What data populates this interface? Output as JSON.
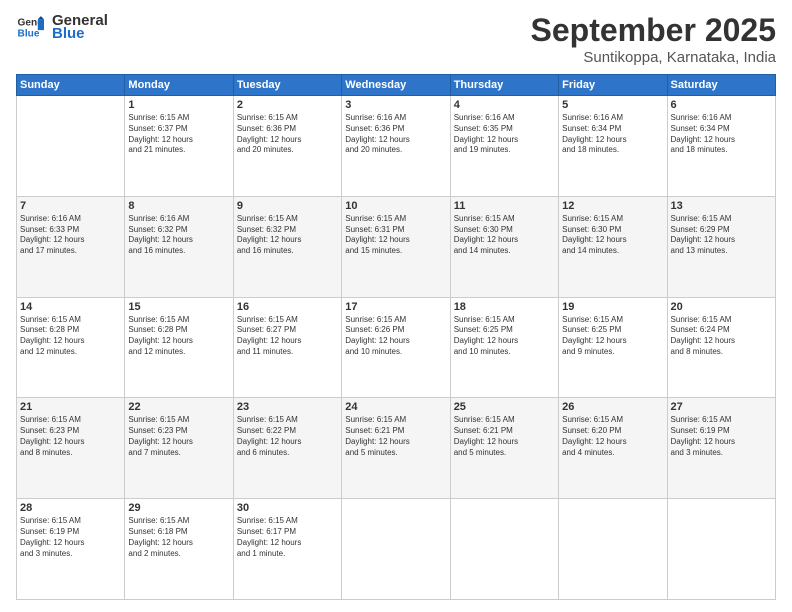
{
  "header": {
    "logo_general": "General",
    "logo_blue": "Blue",
    "month_title": "September 2025",
    "location": "Suntikoppa, Karnataka, India"
  },
  "columns": [
    "Sunday",
    "Monday",
    "Tuesday",
    "Wednesday",
    "Thursday",
    "Friday",
    "Saturday"
  ],
  "weeks": [
    [
      {
        "num": "",
        "info": ""
      },
      {
        "num": "1",
        "info": "Sunrise: 6:15 AM\nSunset: 6:37 PM\nDaylight: 12 hours\nand 21 minutes."
      },
      {
        "num": "2",
        "info": "Sunrise: 6:15 AM\nSunset: 6:36 PM\nDaylight: 12 hours\nand 20 minutes."
      },
      {
        "num": "3",
        "info": "Sunrise: 6:16 AM\nSunset: 6:36 PM\nDaylight: 12 hours\nand 20 minutes."
      },
      {
        "num": "4",
        "info": "Sunrise: 6:16 AM\nSunset: 6:35 PM\nDaylight: 12 hours\nand 19 minutes."
      },
      {
        "num": "5",
        "info": "Sunrise: 6:16 AM\nSunset: 6:34 PM\nDaylight: 12 hours\nand 18 minutes."
      },
      {
        "num": "6",
        "info": "Sunrise: 6:16 AM\nSunset: 6:34 PM\nDaylight: 12 hours\nand 18 minutes."
      }
    ],
    [
      {
        "num": "7",
        "info": "Sunrise: 6:16 AM\nSunset: 6:33 PM\nDaylight: 12 hours\nand 17 minutes."
      },
      {
        "num": "8",
        "info": "Sunrise: 6:16 AM\nSunset: 6:32 PM\nDaylight: 12 hours\nand 16 minutes."
      },
      {
        "num": "9",
        "info": "Sunrise: 6:15 AM\nSunset: 6:32 PM\nDaylight: 12 hours\nand 16 minutes."
      },
      {
        "num": "10",
        "info": "Sunrise: 6:15 AM\nSunset: 6:31 PM\nDaylight: 12 hours\nand 15 minutes."
      },
      {
        "num": "11",
        "info": "Sunrise: 6:15 AM\nSunset: 6:30 PM\nDaylight: 12 hours\nand 14 minutes."
      },
      {
        "num": "12",
        "info": "Sunrise: 6:15 AM\nSunset: 6:30 PM\nDaylight: 12 hours\nand 14 minutes."
      },
      {
        "num": "13",
        "info": "Sunrise: 6:15 AM\nSunset: 6:29 PM\nDaylight: 12 hours\nand 13 minutes."
      }
    ],
    [
      {
        "num": "14",
        "info": "Sunrise: 6:15 AM\nSunset: 6:28 PM\nDaylight: 12 hours\nand 12 minutes."
      },
      {
        "num": "15",
        "info": "Sunrise: 6:15 AM\nSunset: 6:28 PM\nDaylight: 12 hours\nand 12 minutes."
      },
      {
        "num": "16",
        "info": "Sunrise: 6:15 AM\nSunset: 6:27 PM\nDaylight: 12 hours\nand 11 minutes."
      },
      {
        "num": "17",
        "info": "Sunrise: 6:15 AM\nSunset: 6:26 PM\nDaylight: 12 hours\nand 10 minutes."
      },
      {
        "num": "18",
        "info": "Sunrise: 6:15 AM\nSunset: 6:25 PM\nDaylight: 12 hours\nand 10 minutes."
      },
      {
        "num": "19",
        "info": "Sunrise: 6:15 AM\nSunset: 6:25 PM\nDaylight: 12 hours\nand 9 minutes."
      },
      {
        "num": "20",
        "info": "Sunrise: 6:15 AM\nSunset: 6:24 PM\nDaylight: 12 hours\nand 8 minutes."
      }
    ],
    [
      {
        "num": "21",
        "info": "Sunrise: 6:15 AM\nSunset: 6:23 PM\nDaylight: 12 hours\nand 8 minutes."
      },
      {
        "num": "22",
        "info": "Sunrise: 6:15 AM\nSunset: 6:23 PM\nDaylight: 12 hours\nand 7 minutes."
      },
      {
        "num": "23",
        "info": "Sunrise: 6:15 AM\nSunset: 6:22 PM\nDaylight: 12 hours\nand 6 minutes."
      },
      {
        "num": "24",
        "info": "Sunrise: 6:15 AM\nSunset: 6:21 PM\nDaylight: 12 hours\nand 5 minutes."
      },
      {
        "num": "25",
        "info": "Sunrise: 6:15 AM\nSunset: 6:21 PM\nDaylight: 12 hours\nand 5 minutes."
      },
      {
        "num": "26",
        "info": "Sunrise: 6:15 AM\nSunset: 6:20 PM\nDaylight: 12 hours\nand 4 minutes."
      },
      {
        "num": "27",
        "info": "Sunrise: 6:15 AM\nSunset: 6:19 PM\nDaylight: 12 hours\nand 3 minutes."
      }
    ],
    [
      {
        "num": "28",
        "info": "Sunrise: 6:15 AM\nSunset: 6:19 PM\nDaylight: 12 hours\nand 3 minutes."
      },
      {
        "num": "29",
        "info": "Sunrise: 6:15 AM\nSunset: 6:18 PM\nDaylight: 12 hours\nand 2 minutes."
      },
      {
        "num": "30",
        "info": "Sunrise: 6:15 AM\nSunset: 6:17 PM\nDaylight: 12 hours\nand 1 minute."
      },
      {
        "num": "",
        "info": ""
      },
      {
        "num": "",
        "info": ""
      },
      {
        "num": "",
        "info": ""
      },
      {
        "num": "",
        "info": ""
      }
    ]
  ]
}
